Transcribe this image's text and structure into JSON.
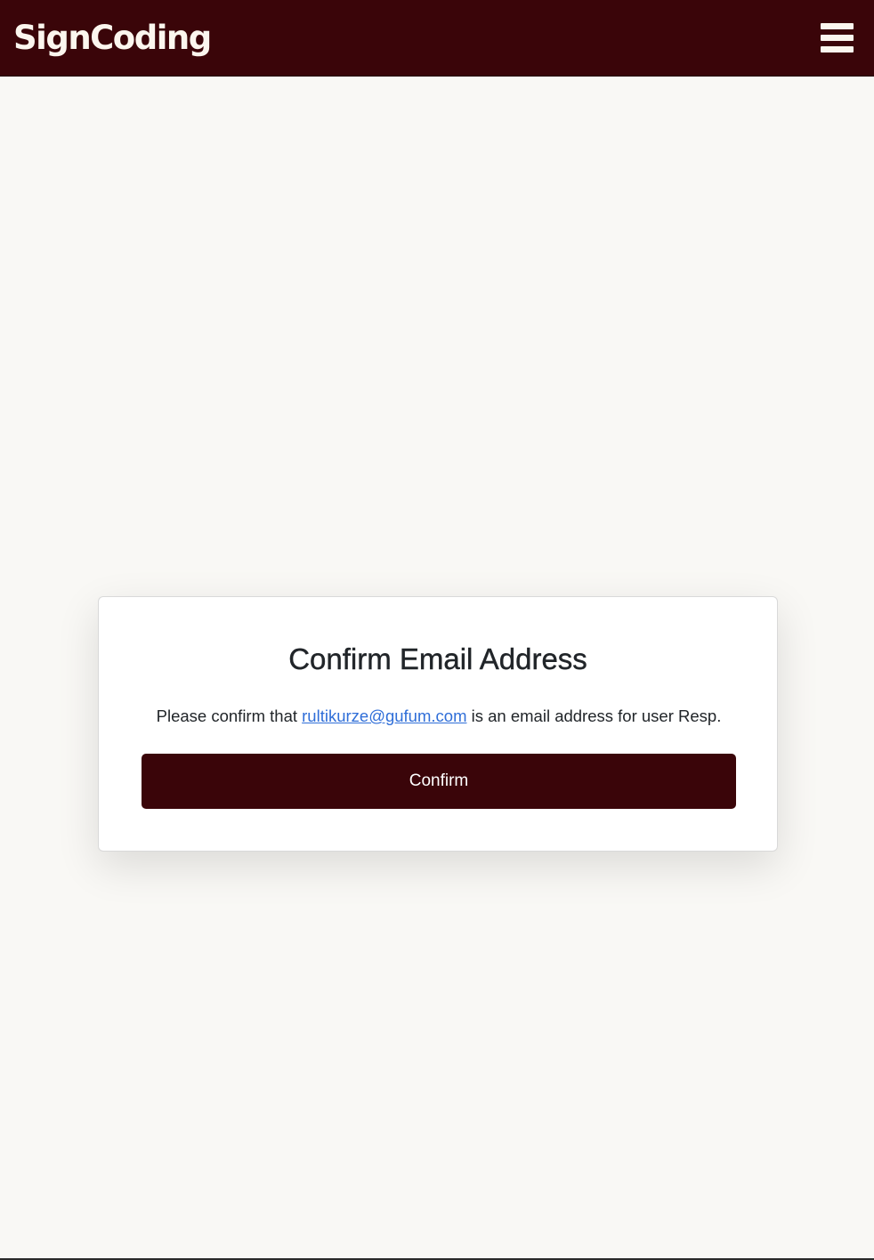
{
  "header": {
    "brand": "SignCoding",
    "menu_icon": "hamburger-menu-icon"
  },
  "card": {
    "title": "Confirm Email Address",
    "text_before": "Please confirm that ",
    "email": "rultikurze@gufum.com",
    "text_after": " is an email address for user Resp.",
    "confirm_label": "Confirm"
  },
  "colors": {
    "header_bg": "#3a0509",
    "page_bg": "#f9f8f5",
    "button_bg": "#3a0509",
    "link": "#2f6ed8",
    "brand_text": "#fbf6ee"
  }
}
